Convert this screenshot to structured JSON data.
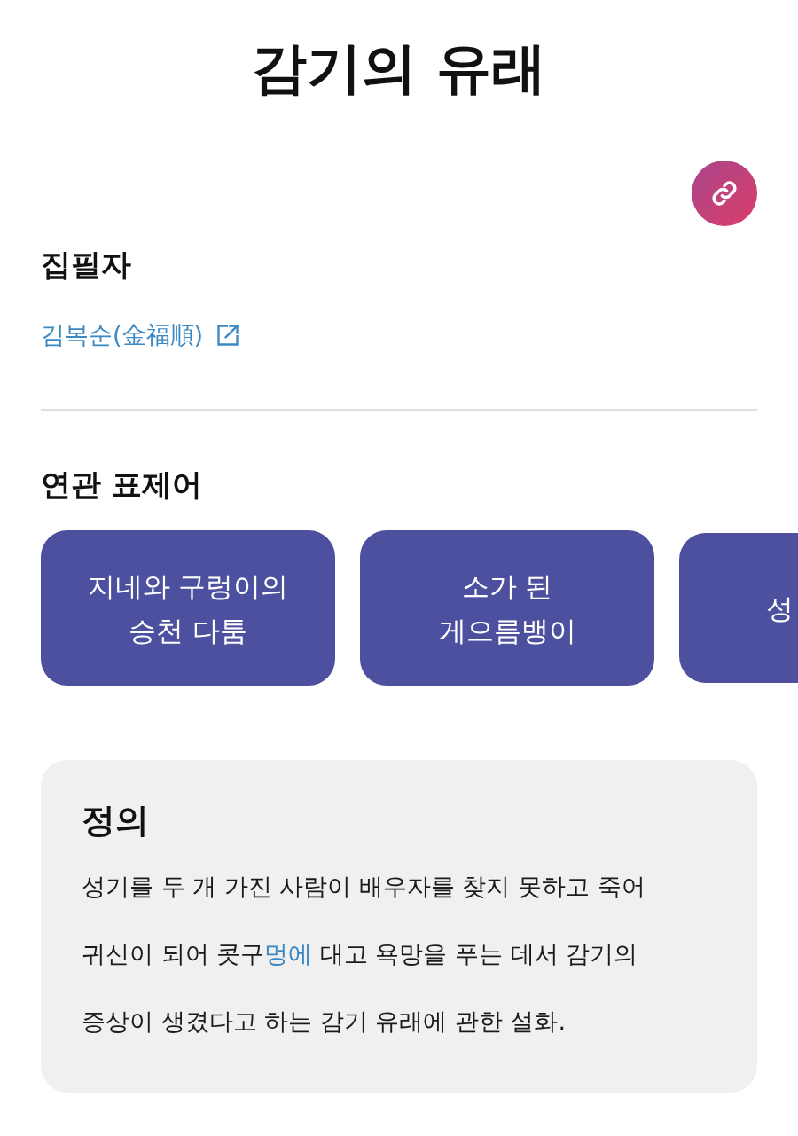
{
  "title": "감기의 유래",
  "author_section": {
    "heading": "집필자",
    "author": "김복순(金福順)"
  },
  "related_section": {
    "heading": "연관 표제어",
    "entries": [
      {
        "label": "지네와 구렁이의 승천 다툼"
      },
      {
        "label": "소가 된 게으름뱅이"
      },
      {
        "label": "성"
      }
    ]
  },
  "definition": {
    "heading": "정의",
    "parts": [
      {
        "kind": "text",
        "text": "성기를 두 개 가진 사람이 배우자를 찾지 못하고 죽어 귀신이 되어 콧구"
      },
      {
        "kind": "link",
        "text": "멍에"
      },
      {
        "kind": "text",
        "text": " 대고 욕망을 푸는 데서 감기의 증상이 생겼다고 하는 감기 유래에 관한 설화."
      }
    ]
  }
}
